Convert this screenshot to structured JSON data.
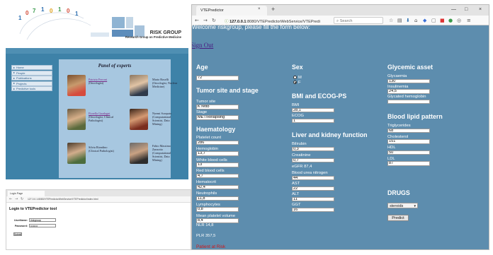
{
  "site": {
    "header_title": "RISK GROUP",
    "header_subtitle": "Research Group on Predictive Medicine",
    "nav": [
      "Home",
      "People",
      "Publications",
      "Projects",
      "Predictive tools"
    ],
    "panel_title": "Panel of experts",
    "experts": [
      {
        "name": "Patrizia Ferroni",
        "role": "(Oncologist)"
      },
      {
        "name": "Mario Roselli",
        "role": "(Oncologist, Nuclear Medicine)"
      },
      {
        "name": "Fiorella Guadagni",
        "role": "(Oncologist, Clinical Pathologist)"
      },
      {
        "name": "Noemi Scarpato",
        "role": "(Computational Scientist, Data Mining)"
      },
      {
        "name": "Silvia Riondino",
        "role": "(Clinical Pathologist)"
      },
      {
        "name": "Fabio Massimo Zanzotto",
        "role": "(Computational Scientist, Data Mining)"
      }
    ],
    "colors": {
      "body_blue": "#3e82a8",
      "panel": "#a7c7e0"
    }
  },
  "login_window": {
    "tab_title": "Login Page",
    "url": "127.0.0.1:8080/VTEPredictorWebService/VTEPredictor/index.html",
    "heading": "Login to VTEPredictor tool",
    "username_label": "UserName:",
    "username_value": "riskgroup",
    "password_label": "Password:",
    "password_value": "••••••••",
    "submit_label": "Submit"
  },
  "browser": {
    "tab_title": "VTEPredictor",
    "url_host": "127.0.0.1",
    "url_path": ":8080/VTEPredictorWebService/VTEPredi",
    "search_placeholder": "Search",
    "new_tab": "+",
    "close_tab": "×",
    "window_controls": [
      "—",
      "□",
      "×"
    ]
  },
  "form": {
    "welcome": "Welcome riskgroup, please fill the form below:",
    "sign_out": "Sign Out",
    "age": {
      "title": "Age",
      "value": "72"
    },
    "tumor": {
      "title": "Tumor site and stage",
      "site_label": "Tumor site",
      "site_value": "K retto",
      "stage_label": "Stage",
      "stage_value": "MET/Relapsing"
    },
    "haematology": {
      "title": "Haematology",
      "fields": [
        {
          "label": "Platelet count",
          "value": "286"
        },
        {
          "label": "Hemoglobin",
          "value": "13,7"
        },
        {
          "label": "White blood cells",
          "value": "13"
        },
        {
          "label": "Red blood cells",
          "value": "4,7"
        },
        {
          "label": "Hematocrit",
          "value": "42,4"
        },
        {
          "label": "Neutrophils",
          "value": "11,8"
        },
        {
          "label": "Lymphocytes",
          "value": "0,8"
        },
        {
          "label": "Mean platelet volume",
          "value": "8,4"
        }
      ],
      "nlr": "NLR 14,8",
      "plr": "PLR 357,5"
    },
    "sex": {
      "title": "Sex",
      "options": [
        "M",
        "F"
      ],
      "selected": "F"
    },
    "bmi": {
      "title": "BMI and ECOG-PS",
      "fields": [
        {
          "label": "BMI",
          "value": "28,1"
        },
        {
          "label": "ECOG",
          "value": "1"
        }
      ]
    },
    "liver": {
      "title": "Liver and kidney function",
      "fields": [
        {
          "label": "Bilirubin",
          "value": "0,3"
        },
        {
          "label": "Creatinine",
          "value": "0,7"
        }
      ],
      "egfr": "eGFR 87,4",
      "fields2": [
        {
          "label": "Blood urea nitrogen",
          "value": "44"
        },
        {
          "label": "AST",
          "value": "22"
        },
        {
          "label": "ALT",
          "value": "11"
        },
        {
          "label": "GGT",
          "value": "16"
        }
      ]
    },
    "glycemic": {
      "title": "Glycemic asset",
      "fields": [
        {
          "label": "Glycaemia",
          "value": "130"
        },
        {
          "label": "Insulinemia",
          "value": "24,5"
        },
        {
          "label": "Glycated hemoglobin",
          "value": ""
        }
      ]
    },
    "lipid": {
      "title": "Blood lipid pattern",
      "fields": [
        {
          "label": "Triglycerides",
          "value": "68"
        },
        {
          "label": "Cholesterol",
          "value": "151"
        },
        {
          "label": "HDL",
          "value": "50"
        },
        {
          "label": "LDL",
          "value": "87"
        }
      ]
    },
    "drugs": {
      "title": "DRUGS",
      "selected": "steroids"
    },
    "predict_label": "Predict",
    "result": "Patient at Risk",
    "colors": {
      "background": "#5d8dae",
      "result": "#d51414",
      "sign_out": "#4a1d82"
    }
  }
}
